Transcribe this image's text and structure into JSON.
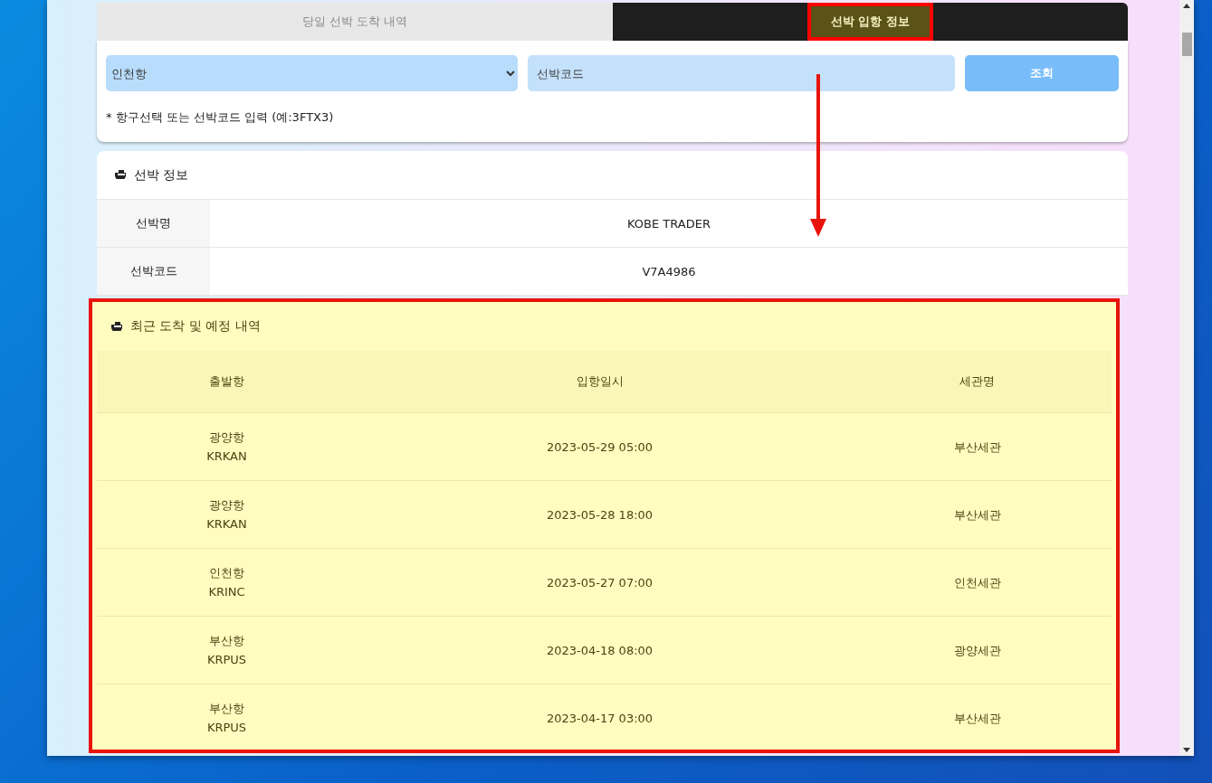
{
  "tabs": [
    {
      "label": "당일 선박 도착 내역",
      "selected": false
    },
    {
      "label": "선박 입항 정보",
      "selected": true
    }
  ],
  "search": {
    "port_select": "인천항",
    "code_field": {
      "placeholder": "선박코드"
    },
    "button": "조회",
    "hint": "* 항구선택 또는 선박코드 입력 (예:3FTX3)"
  },
  "ship_info": {
    "title": "선박 정보",
    "rows": [
      {
        "label": "선박명",
        "value": "KOBE TRADER"
      },
      {
        "label": "선박코드",
        "value": "V7A4986"
      }
    ]
  },
  "arrivals": {
    "title": "최근 도착 및 예정 내역",
    "columns": [
      "출발항",
      "입항일시",
      "세관명"
    ],
    "rows": [
      {
        "port": "광양항",
        "port_code": "KRKAN",
        "datetime": "2023-05-29 05:00",
        "customs": "부산세관"
      },
      {
        "port": "광양항",
        "port_code": "KRKAN",
        "datetime": "2023-05-28 18:00",
        "customs": "부산세관"
      },
      {
        "port": "인천항",
        "port_code": "KRINC",
        "datetime": "2023-05-27 07:00",
        "customs": "인천세관"
      },
      {
        "port": "부산항",
        "port_code": "KRPUS",
        "datetime": "2023-04-18 08:00",
        "customs": "광양세관"
      },
      {
        "port": "부산항",
        "port_code": "KRPUS",
        "datetime": "2023-04-17 03:00",
        "customs": "부산세관"
      }
    ]
  }
}
